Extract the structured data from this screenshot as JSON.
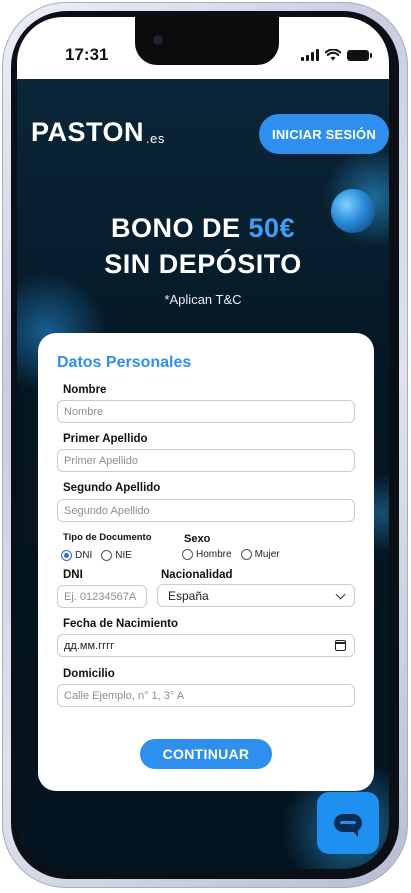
{
  "status_bar": {
    "time": "17:31"
  },
  "header": {
    "logo_text": "PASTON",
    "logo_suffix": ".es",
    "login_label": "INICIAR SESIÓN"
  },
  "promo": {
    "line1_prefix": "BONO DE ",
    "line1_amount": "50€",
    "line2": "SIN DEPÓSITO",
    "terms": "*Aplican T&C"
  },
  "form": {
    "title": "Datos Personales",
    "nombre": {
      "label": "Nombre",
      "placeholder": "Nombre"
    },
    "primer_apellido": {
      "label": "Primer Apellido",
      "placeholder": "Primer Apellido"
    },
    "segundo_apellido": {
      "label": "Segundo Apellido",
      "placeholder": "Segundo Apellido"
    },
    "tipo_documento": {
      "label": "Tipo de Documento",
      "options": [
        "DNI",
        "NIE"
      ],
      "selected": "DNI"
    },
    "sexo": {
      "label": "Sexo",
      "options": [
        "Hombre",
        "Mujer"
      ]
    },
    "dni": {
      "label": "DNI",
      "placeholder": "Ej. 01234567A"
    },
    "nacionalidad": {
      "label": "Nacionalidad",
      "value": "España"
    },
    "fecha_nacimiento": {
      "label": "Fecha de Nacimiento",
      "value": "дд.мм.гггг"
    },
    "domicilio": {
      "label": "Domicilio",
      "placeholder": "Calle Ejemplo, n° 1, 3° A"
    },
    "submit_label": "CONTINUAR"
  },
  "colors": {
    "accent": "#2f8fee",
    "background": "#04121d",
    "card": "#ffffff"
  },
  "icons": [
    "signal-icon",
    "wifi-icon",
    "battery-icon",
    "chevron-down-icon",
    "calendar-icon",
    "chat-icon"
  ]
}
